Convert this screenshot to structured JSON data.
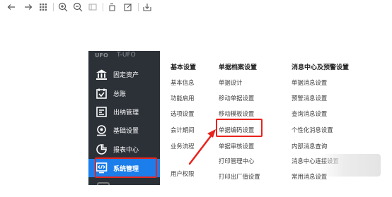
{
  "toolbar": {
    "icons": [
      "back-arrow-icon",
      "forward-arrow-icon",
      "grid-icon",
      "zoom-in-icon",
      "zoom-out-icon",
      "page-icon",
      "rotate-icon",
      "edit-icon",
      "save-icon"
    ]
  },
  "sidebar": {
    "logo": "UFO",
    "logo_sub": "T-UFO",
    "items": [
      {
        "label": "固定资产",
        "icon": "bank-icon"
      },
      {
        "label": "总账",
        "icon": "ledger-icon"
      },
      {
        "label": "出纳管理",
        "icon": "cashier-icon"
      },
      {
        "label": "基础设置",
        "icon": "settings-icon"
      },
      {
        "label": "报表中心",
        "icon": "report-icon"
      },
      {
        "label": "系统管理",
        "icon": "system-icon",
        "active": true
      }
    ],
    "active_color": "#1c7eea",
    "bg_color": "#2c3138"
  },
  "columns": [
    {
      "title": "基本设置",
      "items": [
        "基本信息",
        "功能启用",
        "选项设置",
        "会计期间",
        "业务流程",
        "用户权限"
      ]
    },
    {
      "title": "单据档案设置",
      "items": [
        "单据设计",
        "移动单据设置",
        "移动模板设置",
        "单据编码设置",
        "单据审核设置",
        "打印管理中心",
        "打印出厂值设置"
      ]
    },
    {
      "title": "消息中心及预警设置",
      "items": [
        "单据消息设置",
        "预警消息设置",
        "查询消息设置",
        "个性化消息设置",
        "内部消息查询",
        "消息中心连接设置",
        "常用消息设置"
      ]
    }
  ],
  "highlight_color": "#e8231d"
}
